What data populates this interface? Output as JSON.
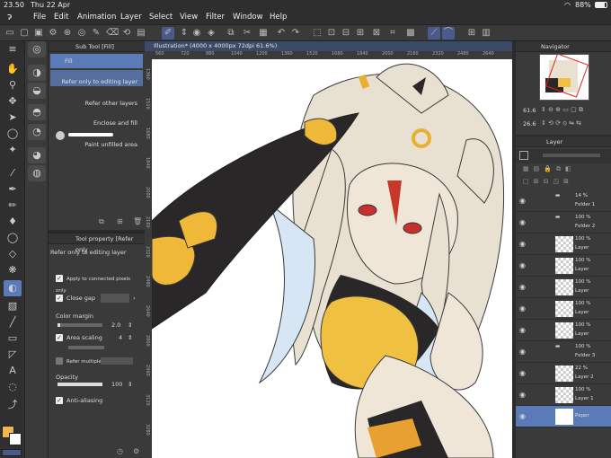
{
  "status": {
    "time": "23.50",
    "date": "Thu 22 Apr",
    "battery": "88%"
  },
  "menu": [
    "File",
    "Edit",
    "Animation",
    "Layer",
    "Select",
    "View",
    "Filter",
    "Window",
    "Help"
  ],
  "sub_tool": {
    "title": "Sub Tool [Fill]",
    "items": [
      {
        "label": "Fill"
      },
      {
        "label": "Refer only to editing layer"
      },
      {
        "label": "Refer other layers"
      },
      {
        "label": "Enclose and fill"
      },
      {
        "label": "Paint unfilled area"
      }
    ]
  },
  "tool_property": {
    "title": "Tool property [Refer only",
    "subtitle": "Refer only to editing layer",
    "apply_connected": "Apply to connected pixels only",
    "close_gap": "Close gap",
    "color_margin_label": "Color margin",
    "color_margin_value": "2.0",
    "area_scaling_label": "Area scaling",
    "area_scaling_value": "4",
    "refer_multiple": "Refer multiple",
    "opacity_label": "Opacity",
    "opacity_value": "100",
    "anti_aliasing": "Anti-aliasing"
  },
  "canvas": {
    "tab": "Illustration* (4000 x 4000px 72dpi 61.6%)",
    "hruler": [
      "560",
      "720",
      "880",
      "1040",
      "1200",
      "1360",
      "1520",
      "1680",
      "1840",
      "2000",
      "2160",
      "2320",
      "2480",
      "2640"
    ],
    "vruler": [
      "1360",
      "1520",
      "1680",
      "1840",
      "2000",
      "2160",
      "2320",
      "2480",
      "2640",
      "2800",
      "2960",
      "3120",
      "3280"
    ]
  },
  "navigator": {
    "title": "Navigator",
    "zoom": "61.6",
    "angle": "26.6"
  },
  "layers": {
    "title": "Layer",
    "items": [
      {
        "pct": "14 %",
        "name": "Folder 1",
        "folder": true
      },
      {
        "pct": "100 %",
        "name": "Folder 2",
        "folder": true
      },
      {
        "pct": "100 %",
        "name": "Layer"
      },
      {
        "pct": "100 %",
        "name": "Layer"
      },
      {
        "pct": "100 %",
        "name": "Layer"
      },
      {
        "pct": "100 %",
        "name": "Layer"
      },
      {
        "pct": "100 %",
        "name": "Layer"
      },
      {
        "pct": "100 %",
        "name": "Folder 3",
        "folder": true
      },
      {
        "pct": "22 %",
        "name": "Layer 2"
      },
      {
        "pct": "100 %",
        "name": "Layer 1"
      },
      {
        "pct": "",
        "name": "Paper"
      }
    ]
  },
  "colors": {
    "main": "#f0b84a",
    "sub": "#ffffff",
    "accent": "#4a5a8a",
    "selected_blue": "#5b7bb8"
  }
}
